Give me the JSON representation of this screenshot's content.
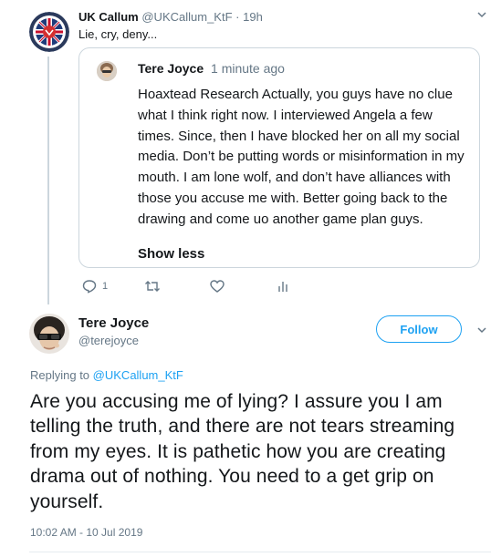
{
  "parent_tweet": {
    "author_name": "UK Callum",
    "author_handle": "@UKCallum_KtF",
    "separator": "·",
    "time": "19h",
    "text": "Lie, cry, deny...",
    "quoted": {
      "author_name": "Tere Joyce",
      "time": "1 minute ago",
      "text": "Hoaxtead Research Actually, you guys have no clue what I think right now. I interviewed Angela a few times. Since, then I have blocked her on all my social media. Don’t be putting words or misinformation in my mouth. I am lone wolf, and don’t have alliances with those you accuse me with. Better going back to the drawing and come uo another game plan guys.",
      "show_less_label": "Show less"
    },
    "actions": {
      "reply_icon": "reply-icon",
      "reply_count": "1",
      "retweet_icon": "retweet-icon",
      "like_icon": "heart-icon",
      "analytics_icon": "analytics-icon"
    }
  },
  "main_tweet": {
    "author_name": "Tere Joyce",
    "author_handle": "@terejoyce",
    "follow_label": "Follow",
    "replying_prefix": "Replying to",
    "replying_to": "@UKCallum_KtF",
    "text": "Are you accusing me of lying? I assure you I am telling the truth, and there are not tears streaming from my eyes. It is pathetic how you are creating drama out of nothing. You need to a get grip on yourself.",
    "timestamp": "10:02 AM - 10 Jul 2019"
  },
  "colors": {
    "accent": "#1da1f2",
    "text": "#14171a",
    "secondary": "#657786",
    "border": "#ccd6dd"
  }
}
